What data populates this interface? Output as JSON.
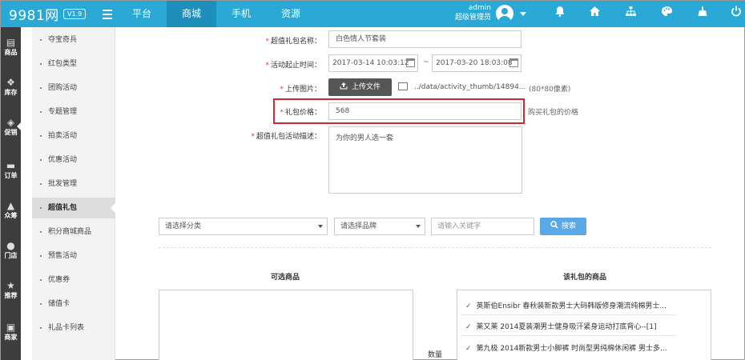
{
  "app": {
    "logo": "9981网",
    "version": "V1.9"
  },
  "topnav": [
    "平台",
    "商城",
    "手机",
    "资源"
  ],
  "user": {
    "name": "admin",
    "role": "超级管理员"
  },
  "icon_col": [
    {
      "label": "商品",
      "icon": "cart-icon"
    },
    {
      "label": "库存",
      "icon": "cubes-icon"
    },
    {
      "label": "促销",
      "icon": "tag-icon"
    },
    {
      "label": "订单",
      "icon": "list-icon"
    },
    {
      "label": "众筹",
      "icon": "users-icon"
    },
    {
      "label": "门店",
      "icon": "map-pin-icon"
    },
    {
      "label": "推荐",
      "icon": "star-icon"
    },
    {
      "label": "商家",
      "icon": "store-icon"
    }
  ],
  "submenu": [
    "夺宝奇兵",
    "红包类型",
    "团购活动",
    "专题管理",
    "拍卖活动",
    "优惠活动",
    "批发管理",
    "超值礼包",
    "积分商城商品",
    "预售活动",
    "优惠券",
    "储值卡",
    "礼品卡列表"
  ],
  "form": {
    "name_label": "超值礼包名称：",
    "name_value": "白色情人节套装",
    "time_label": "活动起止时间：",
    "start_time": "2017-03-14 10:03:12",
    "tilde": "~",
    "end_time": "2017-03-20 18:03:08",
    "image_label": "上传图片：",
    "upload_button": "上传文件",
    "image_path": "../data/activity_thumb/14894...",
    "image_size_hint": "(80*80像素)",
    "price_label": "礼包价格：",
    "price_value": "568",
    "price_hint": "购买礼包的价格",
    "desc_label": "超值礼包活动描述：",
    "desc_value": "为你的男人选一套"
  },
  "filters": {
    "category_placeholder": "请选择分类",
    "brand_placeholder": "请选择品牌",
    "keyword_placeholder": "请输入关键字",
    "search_button": "搜索"
  },
  "goods": {
    "available_title": "可选商品",
    "package_title": "该礼包的商品",
    "quantity_label": "数量",
    "package_items": [
      "英斯伯Ensibr 春秋装新款男士大码韩版修身潮流纯棉男士...",
      "莱又莱 2014夏装潮男士健身吸汗紧身运动打底背心--[1]",
      "第九极 2014新款男士小脚裤 时尚型男纯棉休闲裤 男士多..."
    ]
  },
  "colors": {
    "topbar": "#2aa9d6",
    "topbar_active": "#1e8fba",
    "sidebar": "#3d3d3d",
    "highlight": "#d9232d",
    "search": "#5aa9e6"
  }
}
